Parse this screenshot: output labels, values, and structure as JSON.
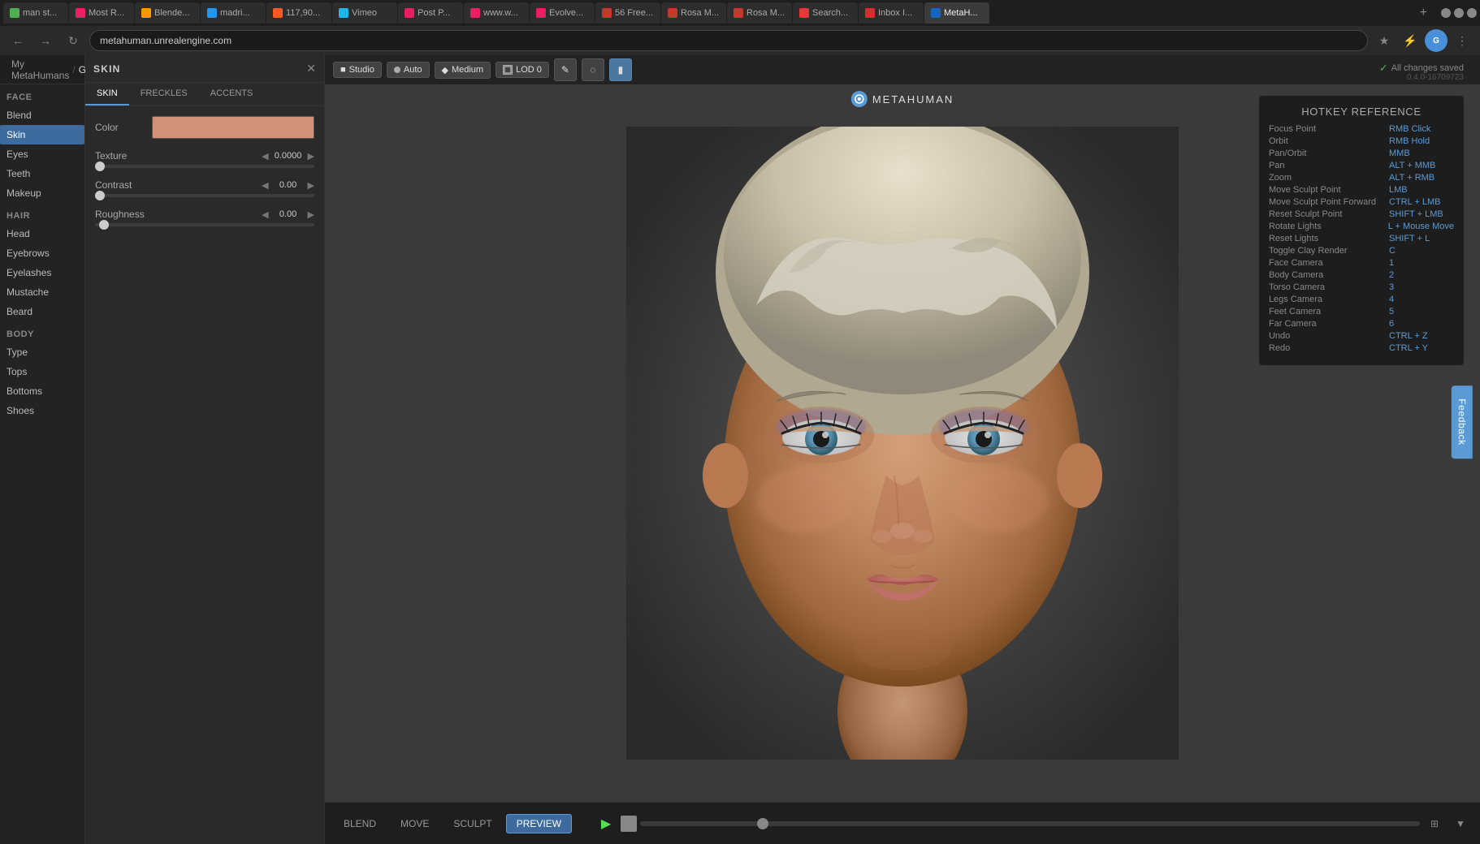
{
  "browser": {
    "tabs": [
      {
        "label": "man st...",
        "active": false,
        "favicon_color": "#4CAF50"
      },
      {
        "label": "Most R...",
        "active": false,
        "favicon_color": "#e91e63"
      },
      {
        "label": "Blende...",
        "active": false,
        "favicon_color": "#FF9800"
      },
      {
        "label": "madri...",
        "active": false,
        "favicon_color": "#2196F3"
      },
      {
        "label": "117,90...",
        "active": false,
        "favicon_color": "#FF5722"
      },
      {
        "label": "Vimeo",
        "active": false,
        "favicon_color": "#1ab7ea"
      },
      {
        "label": "Post P...",
        "active": false,
        "favicon_color": "#e91e63"
      },
      {
        "label": "www.w...",
        "active": false,
        "favicon_color": "#e91e63"
      },
      {
        "label": "Evolve...",
        "active": false,
        "favicon_color": "#e91e63"
      },
      {
        "label": "56 Free...",
        "active": false,
        "favicon_color": "#c0392b"
      },
      {
        "label": "Rosa M...",
        "active": false,
        "favicon_color": "#c0392b"
      },
      {
        "label": "Rosa M...",
        "active": false,
        "favicon_color": "#c0392b"
      },
      {
        "label": "Search...",
        "active": false,
        "favicon_color": "#e53935"
      },
      {
        "label": "Inbox I...",
        "active": false,
        "favicon_color": "#d32f2f"
      },
      {
        "label": "MetaH...",
        "active": true,
        "favicon_color": "#1565c0"
      }
    ],
    "address": "metahuman.unrealengine.com"
  },
  "app": {
    "title": "METAHUMAN",
    "breadcrumb_parent": "My MetaHumans",
    "breadcrumb_current": "Glenda",
    "save_status": "All changes saved",
    "version": "0.4.0-16709723",
    "commit": "2220f1b6-83cb-4b4a-ea01-8d3d91222c47"
  },
  "sidebar": {
    "face_section": "FACE",
    "face_items": [
      {
        "label": "Blend",
        "active": false
      },
      {
        "label": "Skin",
        "active": true
      },
      {
        "label": "Eyes",
        "active": false
      },
      {
        "label": "Teeth",
        "active": false
      },
      {
        "label": "Makeup",
        "active": false
      }
    ],
    "hair_section": "HAIR",
    "hair_items": [
      {
        "label": "Head",
        "active": false
      },
      {
        "label": "Eyebrows",
        "active": false
      },
      {
        "label": "Eyelashes",
        "active": false
      },
      {
        "label": "Mustache",
        "active": false
      },
      {
        "label": "Beard",
        "active": false
      }
    ],
    "body_section": "BODY",
    "body_items": [
      {
        "label": "Type",
        "active": false
      },
      {
        "label": "Tops",
        "active": false
      },
      {
        "label": "Bottoms",
        "active": false
      },
      {
        "label": "Shoes",
        "active": false
      }
    ]
  },
  "skin_panel": {
    "title": "SKIN",
    "tabs": [
      "SKIN",
      "FRECKLES",
      "ACCENTS"
    ],
    "active_tab": "SKIN",
    "color_label": "Color",
    "color_value": "#d4917a",
    "texture_label": "Texture",
    "texture_value": "0.0000",
    "contrast_label": "Contrast",
    "contrast_value": "0.00",
    "roughness_label": "Roughness",
    "roughness_value": "0.00"
  },
  "viewport": {
    "buttons": [
      "Studio",
      "Auto",
      "Medium"
    ],
    "lod_label": "LOD 0",
    "modes": [
      "BLEND",
      "MOVE",
      "SCULPT",
      "PREVIEW"
    ],
    "active_mode": "PREVIEW"
  },
  "hotkeys": {
    "title": "HOTKEY REFERENCE",
    "items": [
      {
        "action": "Focus Point",
        "key": "RMB Click"
      },
      {
        "action": "Orbit",
        "key": "RMB Hold"
      },
      {
        "action": "Pan/Orbit",
        "key": "MMB"
      },
      {
        "action": "Pan",
        "key": "ALT + MMB"
      },
      {
        "action": "Zoom",
        "key": "ALT + RMB"
      },
      {
        "action": "Move Sculpt Point",
        "key": "LMB"
      },
      {
        "action": "Move Sculpt Point Forward",
        "key": "CTRL + LMB"
      },
      {
        "action": "Reset Sculpt Point",
        "key": "SHIFT + LMB"
      },
      {
        "action": "Rotate Lights",
        "key": "L + Mouse Move"
      },
      {
        "action": "Reset Lights",
        "key": "SHIFT + L"
      },
      {
        "action": "Toggle Clay Render",
        "key": "C"
      },
      {
        "action": "Face Camera",
        "key": "1"
      },
      {
        "action": "Body Camera",
        "key": "2"
      },
      {
        "action": "Torso Camera",
        "key": "3"
      },
      {
        "action": "Legs Camera",
        "key": "4"
      },
      {
        "action": "Feet Camera",
        "key": "5"
      },
      {
        "action": "Far Camera",
        "key": "6"
      },
      {
        "action": "Undo",
        "key": "CTRL + Z"
      },
      {
        "action": "Redo",
        "key": "CTRL + Y"
      }
    ]
  },
  "feedback": {
    "label": "Feedback"
  }
}
